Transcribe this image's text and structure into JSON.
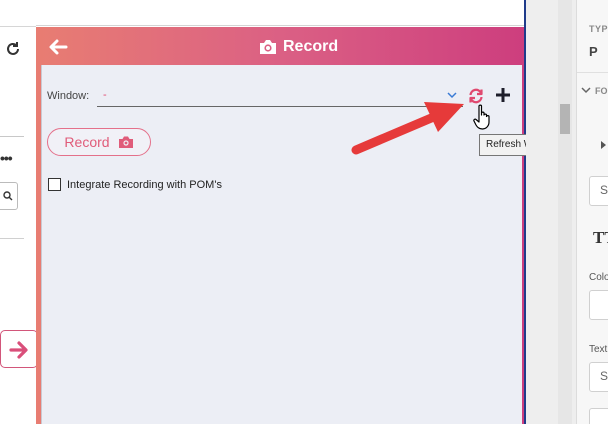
{
  "extension": {
    "header_title": "Record",
    "window_label": "Window:",
    "window_value": "-",
    "record_button_label": "Record",
    "integrate_checkbox_label": "Integrate Recording with POM's",
    "integrate_checked": false
  },
  "tooltip": {
    "text": "Refresh Windows List"
  },
  "properties_panel": {
    "type_heading": "TYP",
    "type_value": "P",
    "font_heading": "FO",
    "style_box_text": "S",
    "text_style_icon": "TT",
    "color_label": "Colo",
    "text_label": "Text",
    "text_box_text": "S"
  },
  "colors": {
    "accent": "#d94f7a",
    "gradient_start": "#e87d72",
    "gradient_end": "#cd3e7e",
    "annotation_arrow": "#e63a3a"
  },
  "icons": {
    "back": "arrow-left-icon",
    "camera": "camera-icon",
    "refresh": "refresh-icon",
    "add": "plus-icon",
    "chevron": "chevron-down-icon",
    "search": "search-icon",
    "next": "arrow-right-icon",
    "cursor": "hand-pointer-icon"
  }
}
